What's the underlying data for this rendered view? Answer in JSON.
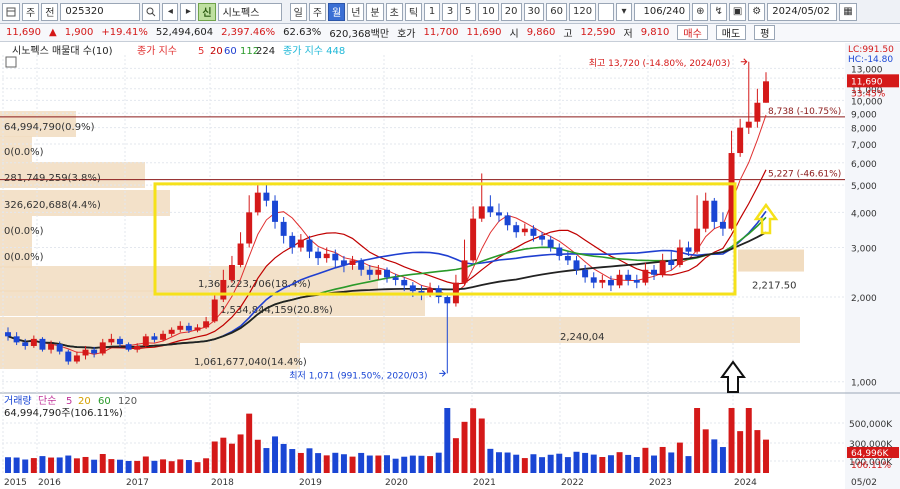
{
  "toolbar": {
    "menu_icon": "menu-icon",
    "type_select": "주",
    "period_select": "전",
    "code": "025320",
    "market_badge": "신",
    "stock_name": "시노펙스",
    "periods": [
      "일",
      "주",
      "월",
      "년",
      "분",
      "초",
      "틱"
    ],
    "selected_period": "월",
    "intervals": [
      "1",
      "3",
      "5",
      "10",
      "20",
      "30",
      "60",
      "120"
    ],
    "count": "106/240",
    "date": "2024/05/02"
  },
  "quote": {
    "price": "11,690",
    "change": "1,900",
    "change_pct": "+19.41%",
    "volume": "52,494,604",
    "volume_pct": "2,397.46%",
    "ratio": "62.63%",
    "amount": "620,368백만",
    "ask_label": "호가",
    "ask": "11,700",
    "bid": "11,690",
    "open_label": "시",
    "open": "9,860",
    "high_label": "고",
    "high": "12,590",
    "low_label": "저",
    "low": "9,810",
    "buy_label": "매수",
    "sell_label": "매도",
    "eval_label": "평"
  },
  "legend": {
    "item1": "시노펙스 매물대 수(10)",
    "ma_label": "종가 지수",
    "ma_periods": [
      "5",
      "20",
      "60",
      "112",
      "224"
    ],
    "ma448": "종가 지수 448"
  },
  "colors": {
    "up": "#d41919",
    "down": "#1a46d4",
    "ma5": "#e03030",
    "ma20": "#c00000",
    "ma60": "#1f3fd0",
    "ma112": "#2a9a2a",
    "ma224": "#222222",
    "highlight": "#f5e11a",
    "volume_profile": "#f1dcc0"
  },
  "chart_data": {
    "type": "candlestick",
    "scale": "log",
    "ylim": [
      950,
      14500
    ],
    "y_ticks": [
      1000,
      2000,
      3000,
      4000,
      5000,
      6000,
      7000,
      8000,
      9000,
      10000,
      11000,
      12000,
      13000
    ],
    "y_tick_labels": [
      "1,000",
      "2,000",
      "3,000",
      "4,000",
      "5,000",
      "6,000",
      "7,000",
      "8,000",
      "9,000",
      "10,000",
      "11,000",
      "12,000",
      "13,000"
    ],
    "x_years": [
      "2015",
      "2016",
      "2017",
      "2018",
      "2019",
      "2020",
      "2021",
      "2022",
      "2023",
      "2024",
      "05/02"
    ],
    "corner_lc": "LC:991.50",
    "corner_hc": "HC:-14.80",
    "current_price": "11,690",
    "current_pct": "33.45%",
    "level_lines": [
      {
        "value": 8738,
        "label": "8,738 (-10.75%)"
      },
      {
        "value": 5227,
        "label": "5,227 (-46.61%)"
      }
    ],
    "high_annotation": "최고 13,720 (-14.80%, 2024/03)",
    "low_annotation": "최저 1,071 (991.50%, 2020/03)",
    "ma224_end_label": "2,217.50",
    "volume_profile": [
      {
        "label": "64,994,790(0.9%)"
      },
      {
        "label": "0(0.0%)"
      },
      {
        "label": "281,749,259(3.8%)"
      },
      {
        "label": "326,620,688(4.4%)"
      },
      {
        "label": "0(0.0%)"
      },
      {
        "label": "0(0.0%)"
      },
      {
        "label": "1,361,223,706(18.4%)"
      },
      {
        "label": "1,534,844,159(20.8%)"
      },
      {
        "label": "2,240,04"
      },
      {
        "label": "1,061,677,040(14.4%)"
      }
    ],
    "candles": [
      [
        1500,
        1450,
        1560,
        1400
      ],
      [
        1450,
        1380,
        1500,
        1350
      ],
      [
        1380,
        1340,
        1420,
        1300
      ],
      [
        1340,
        1420,
        1460,
        1320
      ],
      [
        1420,
        1300,
        1440,
        1280
      ],
      [
        1300,
        1360,
        1400,
        1260
      ],
      [
        1360,
        1280,
        1390,
        1250
      ],
      [
        1280,
        1180,
        1300,
        1150
      ],
      [
        1180,
        1240,
        1280,
        1160
      ],
      [
        1240,
        1300,
        1340,
        1200
      ],
      [
        1300,
        1260,
        1330,
        1220
      ],
      [
        1260,
        1380,
        1420,
        1240
      ],
      [
        1380,
        1420,
        1480,
        1350
      ],
      [
        1420,
        1360,
        1450,
        1330
      ],
      [
        1360,
        1300,
        1380,
        1280
      ],
      [
        1300,
        1340,
        1370,
        1270
      ],
      [
        1340,
        1450,
        1480,
        1320
      ],
      [
        1450,
        1410,
        1490,
        1380
      ],
      [
        1410,
        1480,
        1520,
        1390
      ],
      [
        1480,
        1530,
        1560,
        1450
      ],
      [
        1530,
        1580,
        1640,
        1500
      ],
      [
        1580,
        1520,
        1620,
        1490
      ],
      [
        1520,
        1560,
        1600,
        1500
      ],
      [
        1560,
        1640,
        1700,
        1540
      ],
      [
        1640,
        1960,
        2050,
        1620
      ],
      [
        1960,
        2300,
        2500,
        1920
      ],
      [
        2300,
        2600,
        2800,
        2250
      ],
      [
        2600,
        3100,
        3400,
        2550
      ],
      [
        3100,
        4000,
        4600,
        3000
      ],
      [
        4000,
        4700,
        5000,
        3900
      ],
      [
        4700,
        4400,
        5050,
        4200
      ],
      [
        4400,
        3700,
        4600,
        3500
      ],
      [
        3700,
        3300,
        3850,
        3100
      ],
      [
        3300,
        3000,
        3400,
        2850
      ],
      [
        3000,
        3200,
        3350,
        2900
      ],
      [
        3200,
        2900,
        3300,
        2750
      ],
      [
        2900,
        2750,
        3000,
        2600
      ],
      [
        2750,
        2850,
        3000,
        2650
      ],
      [
        2850,
        2700,
        2950,
        2550
      ],
      [
        2700,
        2600,
        2800,
        2450
      ],
      [
        2600,
        2700,
        2800,
        2500
      ],
      [
        2700,
        2500,
        2750,
        2380
      ],
      [
        2500,
        2400,
        2600,
        2300
      ],
      [
        2400,
        2500,
        2600,
        2300
      ],
      [
        2500,
        2350,
        2550,
        2250
      ],
      [
        2350,
        2300,
        2420,
        2200
      ],
      [
        2300,
        2200,
        2350,
        2100
      ],
      [
        2200,
        2100,
        2260,
        2000
      ],
      [
        2100,
        2050,
        2200,
        1950
      ],
      [
        2050,
        2150,
        2250,
        2000
      ],
      [
        2150,
        2000,
        2200,
        1900
      ],
      [
        2000,
        1900,
        2050,
        1071
      ],
      [
        1900,
        2250,
        2400,
        1850
      ],
      [
        2250,
        2700,
        3200,
        2200
      ],
      [
        2700,
        3800,
        4200,
        2650
      ],
      [
        3800,
        4200,
        5500,
        3700
      ],
      [
        4200,
        4000,
        4600,
        3850
      ],
      [
        4000,
        3900,
        4300,
        3700
      ],
      [
        3900,
        3600,
        4000,
        3450
      ],
      [
        3600,
        3400,
        3700,
        3250
      ],
      [
        3400,
        3500,
        3650,
        3300
      ],
      [
        3500,
        3300,
        3600,
        3150
      ],
      [
        3300,
        3200,
        3400,
        3050
      ],
      [
        3200,
        3000,
        3300,
        2900
      ],
      [
        3000,
        2800,
        3100,
        2700
      ],
      [
        2800,
        2700,
        2900,
        2600
      ],
      [
        2700,
        2500,
        2800,
        2400
      ],
      [
        2500,
        2350,
        2600,
        2250
      ],
      [
        2350,
        2250,
        2450,
        2150
      ],
      [
        2250,
        2300,
        2400,
        2150
      ],
      [
        2300,
        2200,
        2380,
        2100
      ],
      [
        2200,
        2400,
        2500,
        2150
      ],
      [
        2400,
        2300,
        2500,
        2200
      ],
      [
        2300,
        2250,
        2400,
        2150
      ],
      [
        2250,
        2500,
        2650,
        2200
      ],
      [
        2500,
        2400,
        2600,
        2300
      ],
      [
        2400,
        2700,
        2850,
        2350
      ],
      [
        2700,
        2600,
        2900,
        2500
      ],
      [
        2600,
        3000,
        3200,
        2550
      ],
      [
        3000,
        2900,
        3150,
        2800
      ],
      [
        2900,
        3500,
        4600,
        2850
      ],
      [
        3500,
        4400,
        4700,
        3400
      ],
      [
        4400,
        3700,
        4500,
        3500
      ],
      [
        3700,
        3500,
        4000,
        3300
      ],
      [
        3500,
        6500,
        7800,
        3450
      ],
      [
        6500,
        8000,
        8600,
        6300
      ],
      [
        8000,
        8400,
        13720,
        7600
      ],
      [
        8400,
        9810,
        11000,
        8000
      ],
      [
        9810,
        11690,
        12590,
        9810
      ]
    ],
    "volume_ylabels": [
      "500,000K",
      "300,000K",
      "100,000K"
    ],
    "volume_current": "64,996K",
    "volume_current_pct": "106.11%"
  },
  "volume_legend": {
    "label": "거래량",
    "ma_label": "단순",
    "ma_periods": [
      "5",
      "20",
      "60",
      "120"
    ],
    "value": "64,994,790주(106.11%)"
  }
}
